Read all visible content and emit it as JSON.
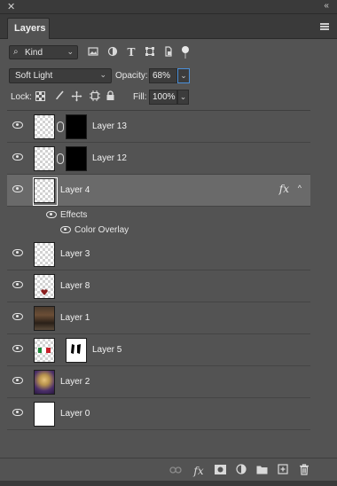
{
  "panel": {
    "close_glyph": "✕",
    "collapse_glyph": "‹‹",
    "tab_label": "Layers",
    "menu_icon": "panel-menu-icon"
  },
  "filter": {
    "kind_label": "Kind",
    "kind_icon": "search-icon",
    "chevron": "⌄",
    "icons": [
      "image-filter-icon",
      "adjustment-filter-icon",
      "type-filter-icon",
      "shape-filter-icon",
      "smart-object-filter-icon",
      "filter-toggle-icon"
    ]
  },
  "blend": {
    "mode": "Soft Light",
    "opacity_label": "Opacity:",
    "opacity_value": "68%"
  },
  "lock": {
    "label": "Lock:",
    "fill_label": "Fill:",
    "fill_value": "100%"
  },
  "layers": [
    {
      "name": "Layer 13",
      "visible": true,
      "has_mask": true,
      "mask": "black"
    },
    {
      "name": "Layer 12",
      "visible": true,
      "has_mask": true,
      "mask": "black"
    },
    {
      "name": "Layer 4",
      "visible": true,
      "selected": true,
      "fx": "fx",
      "effects_label": "Effects",
      "effect_item": "Color Overlay"
    },
    {
      "name": "Layer 3",
      "visible": true
    },
    {
      "name": "Layer 8",
      "visible": true
    },
    {
      "name": "Layer 1",
      "visible": true
    },
    {
      "name": "Layer 5",
      "visible": true,
      "has_mask": true,
      "mask": "white"
    },
    {
      "name": "Layer 2",
      "visible": true
    },
    {
      "name": "Layer 0",
      "visible": true
    }
  ],
  "footer": {
    "icons": [
      "link-layers-icon",
      "fx-icon",
      "add-mask-icon",
      "adjustment-layer-icon",
      "new-group-icon",
      "new-layer-icon",
      "delete-icon"
    ],
    "fx_text": "fx"
  }
}
